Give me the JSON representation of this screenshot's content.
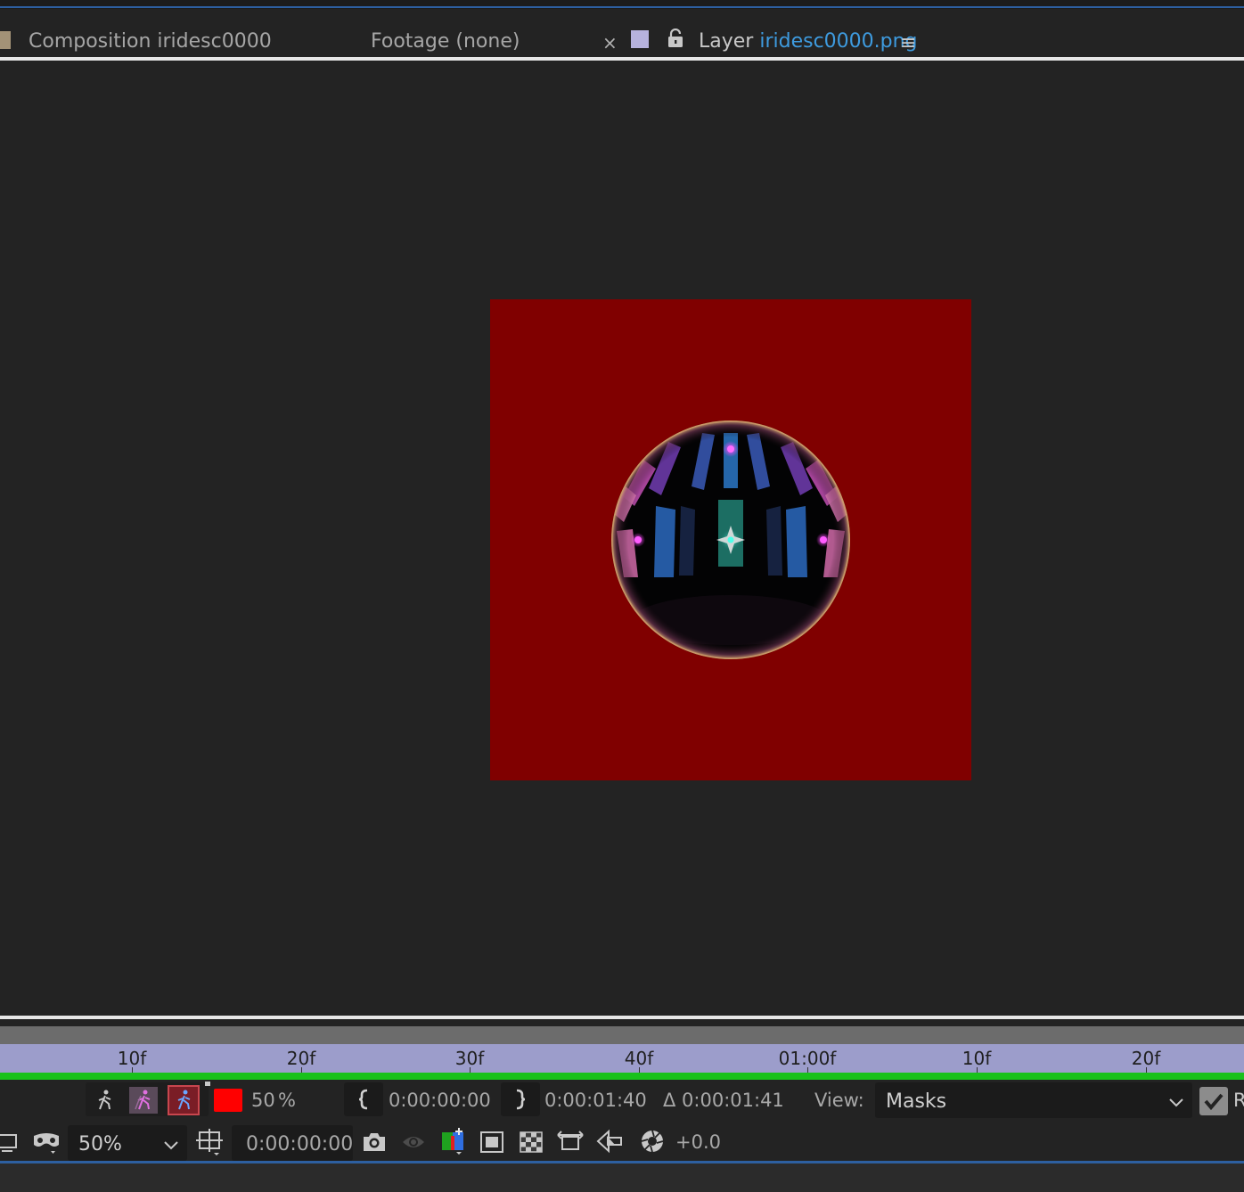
{
  "tabs": {
    "composition": "Composition iridesc0000",
    "footage": "Footage (none)",
    "close": "×",
    "layer_prefix": "Layer",
    "layer_name": "iridesc0000.png",
    "menu": "≡"
  },
  "timeline": {
    "ruler_labels": [
      "10f",
      "20f",
      "30f",
      "40f",
      "01:00f",
      "10f",
      "20f"
    ]
  },
  "controls_row1": {
    "color_swatch": "#ff0000",
    "opacity_value": "50",
    "opacity_unit": "%",
    "in_point": "0:00:00:00",
    "out_point": "0:00:01:40",
    "duration": "Δ 0:00:01:41",
    "view_label": "View:",
    "view_value": "Masks",
    "render_label_partial": "R"
  },
  "controls_row2": {
    "zoom": "50%",
    "current_time": "0:00:00:00",
    "exposure": "+0.0"
  },
  "colors": {
    "accent_blue": "#3e9bdf",
    "layer_background": "#800000",
    "ruler_bg": "#9c9dcb",
    "work_area": "#19c11b"
  }
}
